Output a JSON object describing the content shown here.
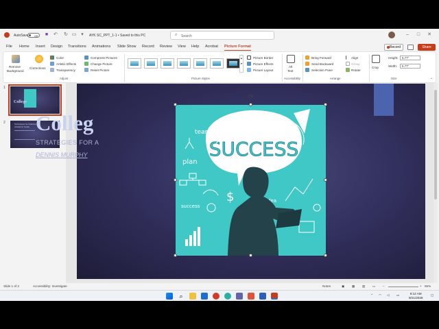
{
  "titlebar": {
    "autosave_label": "AutoSave",
    "autosave_state": "Off",
    "doc_title": "AYK SC_PPT_1-1 • Saved to this PC",
    "search_placeholder": "Search"
  },
  "menu_tabs": [
    "File",
    "Home",
    "Insert",
    "Design",
    "Transitions",
    "Animations",
    "Slide Show",
    "Record",
    "Review",
    "View",
    "Help",
    "Acrobat",
    "Picture Format"
  ],
  "menu_active": "Picture Format",
  "record_label": "Record",
  "share_label": "Share",
  "ribbon": {
    "remove_background": [
      "Remove",
      "Background"
    ],
    "corrections": "Corrections",
    "color": "Color",
    "artistic_effects": "Artistic Effects",
    "transparency": "Transparency",
    "compress_pictures": "Compress Pictures",
    "change_picture": "Change Picture",
    "reset_picture": "Reset Picture",
    "group_adjust": "Adjust",
    "picture_border": "Picture Border",
    "picture_effects": "Picture Effects",
    "picture_layout": "Picture Layout",
    "group_picture_styles": "Picture Styles",
    "alt_text": [
      "Alt",
      "Text"
    ],
    "group_accessibility": "Accessibility",
    "bring_forward": "Bring Forward",
    "send_backward": "Send Backward",
    "selection_pane": "Selection Pane",
    "align": "Align",
    "group": "Group",
    "rotate": "Rotate",
    "group_arrange": "Arrange",
    "crop": "Crop",
    "height_label": "Height:",
    "height_value": "5.77\"",
    "width_label": "Width:",
    "width_value": "5.77\"",
    "group_size": "Size"
  },
  "thumbnails": [
    {
      "num": "1",
      "title": "College"
    },
    {
      "num": "2",
      "title": "Techniques for Attaining Academic Goals"
    }
  ],
  "slide": {
    "title": "Colleg",
    "subtitle": "STRATEGIES FOR A",
    "author": "DENNIS MURPHY",
    "picture_word": "SUCCESS",
    "doodles": [
      "team",
      "plan",
      "success",
      "$",
      "idea"
    ]
  },
  "status": {
    "slide_of": "Slide 1 of 2",
    "accessibility": "Accessibility: Investigate",
    "notes": "Notes",
    "zoom": "65%"
  },
  "clock": {
    "time": "9:12 AM",
    "date": "9/21/2026"
  },
  "colors": {
    "accent": "#c43e1c",
    "slide_bg": "#33315f",
    "picture_bg": "#3fc8c6",
    "silhouette": "#24424a"
  }
}
